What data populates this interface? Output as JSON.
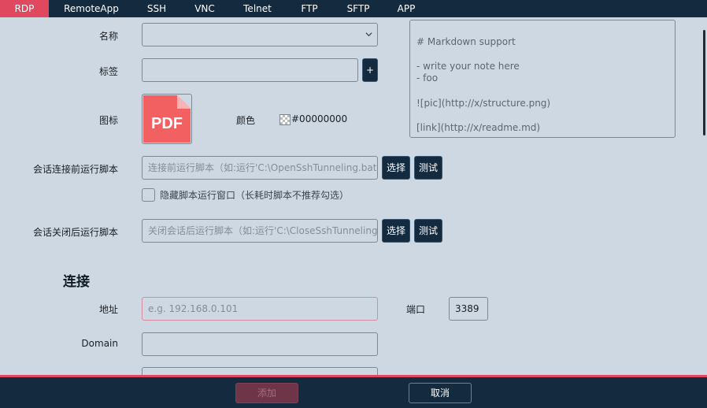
{
  "tabs": [
    "RDP",
    "RemoteApp",
    "SSH",
    "VNC",
    "Telnet",
    "FTP",
    "SFTP",
    "APP"
  ],
  "active_tab": "RDP",
  "form": {
    "name_label": "名称",
    "name_value": "",
    "tag_label": "标签",
    "tag_value": "",
    "add_tag_button": "+",
    "icon_label": "图标",
    "icon_text": "PDF",
    "color_label": "颜色",
    "color_value": "#00000000",
    "pre_script_label": "会话连接前运行脚本",
    "pre_script_placeholder": "连接前运行脚本（如:运行'C:\\OpenSshTunneling.bat",
    "choose_button": "选择",
    "test_button": "测试",
    "hide_window_label": "隐藏脚本运行窗口（长耗时脚本不推荐勾选）",
    "hide_window_checked": false,
    "post_script_label": "会话关闭后运行脚本",
    "post_script_placeholder": "关闭会话后运行脚本（如:运行'C:\\CloseSshTunneling"
  },
  "note": {
    "lines": [
      "",
      "# Markdown support",
      "",
      "- write your note here",
      "- foo",
      "",
      "![pic](http://x/structure.png)",
      "",
      "[link](http://x/readme.md)"
    ]
  },
  "connection": {
    "section_title": "连接",
    "address_label": "地址",
    "address_placeholder": "e.g. 192.168.0.101",
    "port_label": "端口",
    "port_value": "3389",
    "domain_label": "Domain",
    "domain_value": ""
  },
  "footer": {
    "add_button": "添加",
    "cancel_button": "取消"
  },
  "colors": {
    "accent": "#e0485f",
    "dark": "#132a3f",
    "background": "#cdd8e2",
    "pdf_red": "#f36062"
  },
  "icons": {
    "name_dropdown": "chevron-down-icon",
    "icon_preview": "pdf-icon",
    "color_swatch": "transparent-checker-icon"
  }
}
